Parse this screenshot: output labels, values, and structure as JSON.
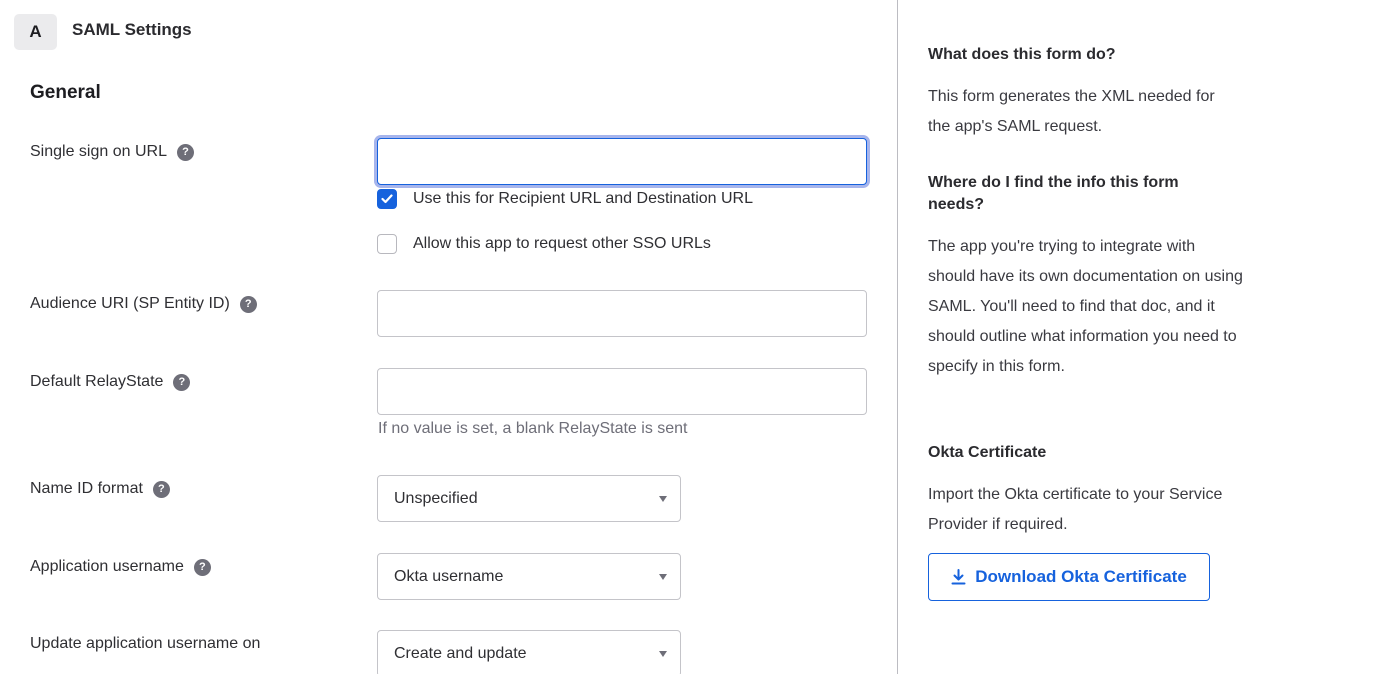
{
  "step": {
    "badge": "A",
    "title": "SAML Settings"
  },
  "section": {
    "title": "General"
  },
  "fields": {
    "sso_url": {
      "label": "Single sign on URL",
      "value": "",
      "help_icon": "question-circle-icon"
    },
    "recipient_checkbox": {
      "label": "Use this for Recipient URL and Destination URL",
      "checked": true
    },
    "other_sso_checkbox": {
      "label": "Allow this app to request other SSO URLs",
      "checked": false
    },
    "audience_uri": {
      "label": "Audience URI (SP Entity ID)",
      "value": ""
    },
    "relay_state": {
      "label": "Default RelayState",
      "value": "",
      "hint": "If no value is set, a blank RelayState is sent"
    },
    "name_id_format": {
      "label": "Name ID format",
      "selected": "Unspecified"
    },
    "app_username": {
      "label": "Application username",
      "selected": "Okta username"
    },
    "update_username_on": {
      "label": "Update application username on",
      "selected": "Create and update"
    }
  },
  "help_icon_glyph": "?",
  "aside": {
    "q1_title": "What does this form do?",
    "q1_body": "This form generates the XML needed for the app's SAML request.",
    "q2_title": "Where do I find the info this form needs?",
    "q2_body": "The app you're trying to integrate with should have its own documentation on using SAML. You'll need to find that doc, and it should outline what information you need to specify in this form.",
    "cert_title": "Okta Certificate",
    "cert_body": "Import the Okta certificate to your Service Provider if required.",
    "download_label": "Download Okta Certificate"
  },
  "colors": {
    "accent": "#1662dd",
    "focus_ring": "#a7b5ec",
    "help_icon": "#6e6e78"
  }
}
